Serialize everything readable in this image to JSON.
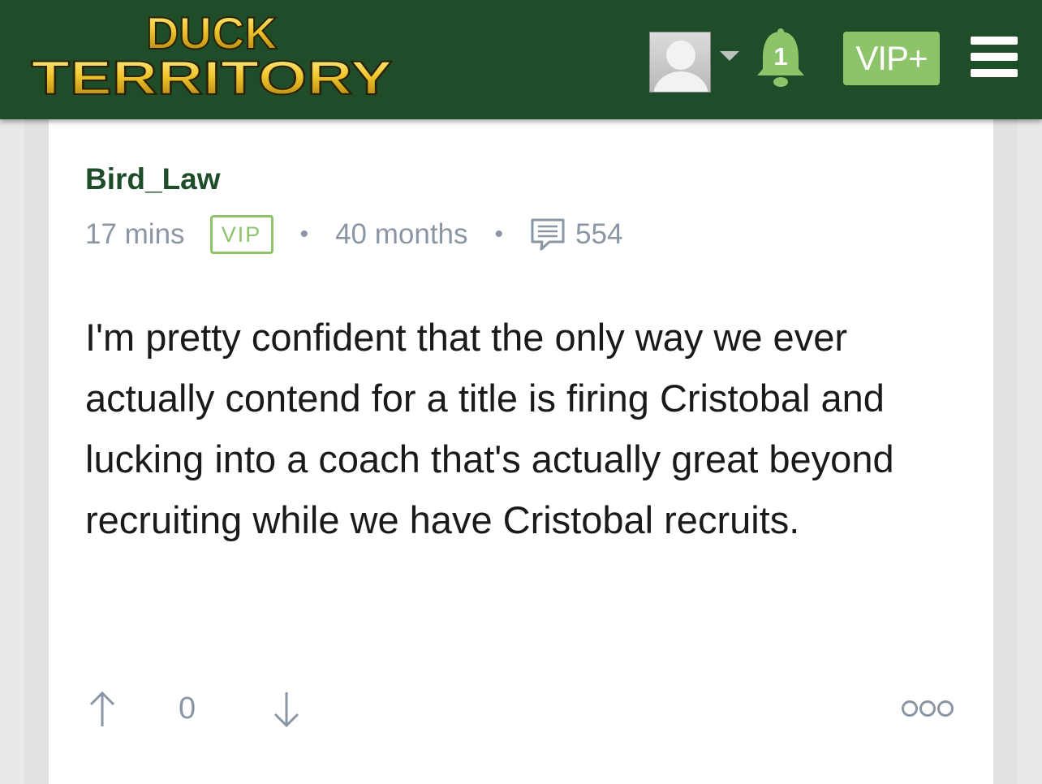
{
  "header": {
    "logo_line1": "DUCK",
    "logo_line2": "TERRITORY",
    "notification_count": "1",
    "vip_button_label": "VIP+",
    "icons": [
      "avatar",
      "chevron-down-icon",
      "bell-icon",
      "hamburger-menu-icon"
    ]
  },
  "post": {
    "username": "Bird_Law",
    "time_ago": "17 mins",
    "badge": "VIP",
    "membership": "40 months",
    "comment_count": "554",
    "body": "I'm pretty confident that the only way we ever actually contend for a title is firing Cristobal and lucking into a coach that's actually great beyond recruiting while we have Cristobal recruits.",
    "vote_count": "0"
  },
  "colors": {
    "header_bg": "#1f4d29",
    "accent_green": "#8dc46a",
    "username": "#1f4d29",
    "meta_gray": "#8a96a3",
    "logo_gold": "#e8c22a"
  }
}
